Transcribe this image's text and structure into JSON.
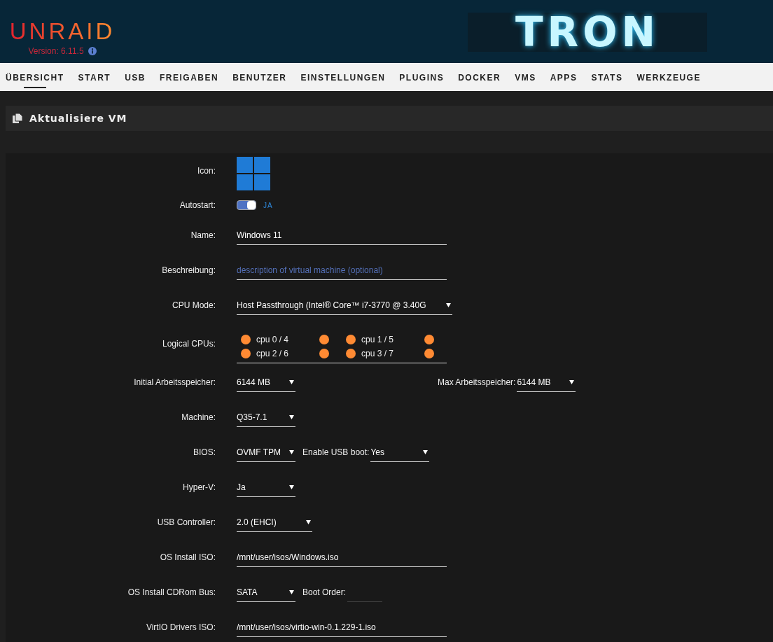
{
  "header": {
    "logo": "UNRAID",
    "version": "Version: 6.11.5",
    "banner_text": "TRON"
  },
  "nav": [
    {
      "label": "ÜBERSICHT",
      "selected": true
    },
    {
      "label": "START",
      "selected": false
    },
    {
      "label": "USB",
      "selected": false
    },
    {
      "label": "FREIGABEN",
      "selected": false
    },
    {
      "label": "BENUTZER",
      "selected": false
    },
    {
      "label": "EINSTELLUNGEN",
      "selected": false
    },
    {
      "label": "PLUGINS",
      "selected": false
    },
    {
      "label": "DOCKER",
      "selected": false
    },
    {
      "label": "VMS",
      "selected": false
    },
    {
      "label": "APPS",
      "selected": false
    },
    {
      "label": "STATS",
      "selected": false
    },
    {
      "label": "WERKZEUGE",
      "selected": false
    }
  ],
  "section": {
    "title": "Aktualisiere VM"
  },
  "form": {
    "rows": [
      {
        "label": "Icon:",
        "controls": [
          {
            "kind": "os-icon"
          }
        ]
      },
      {
        "label": "Autostart:",
        "controls": [
          {
            "kind": "toggle",
            "on": true,
            "text": "JA"
          }
        ]
      },
      {
        "label": "Name:",
        "controls": [
          {
            "kind": "input",
            "value": "Windows 11"
          }
        ]
      },
      {
        "label": "Beschreibung:",
        "controls": [
          {
            "kind": "input",
            "placeholder": "description of virtual machine (optional)"
          }
        ]
      },
      {
        "label": "CPU Mode:",
        "controls": [
          {
            "kind": "select",
            "value": "Host Passthrough (Intel® Core™ i7-3770 @ 3.40G"
          }
        ]
      },
      {
        "label": "Logical CPUs:",
        "controls": [
          {
            "kind": "cpus",
            "cpus": [
              {
                "label": "cpu 0 / 4",
                "checked": true,
                "second_checked": true
              },
              {
                "label": "cpu 1 / 5",
                "checked": true,
                "second_checked": true
              },
              {
                "label": "cpu 2 / 6",
                "checked": true,
                "second_checked": true
              },
              {
                "label": "cpu 3 / 7",
                "checked": true,
                "second_checked": true
              }
            ]
          }
        ]
      },
      {
        "label": "Initial Arbeitsspeicher:",
        "controls": [
          {
            "kind": "select",
            "value": "6144 MB"
          },
          {
            "kind": "label",
            "text": "Max Arbeitsspeicher:"
          },
          {
            "kind": "select",
            "value": "6144 MB"
          }
        ]
      },
      {
        "label": "Machine:",
        "controls": [
          {
            "kind": "select",
            "value": "Q35-7.1"
          }
        ]
      },
      {
        "label": "BIOS:",
        "controls": [
          {
            "kind": "select",
            "value": "OVMF TPM"
          },
          {
            "kind": "label",
            "text": "Enable USB boot:"
          },
          {
            "kind": "select",
            "value": "Yes"
          }
        ]
      },
      {
        "label": "Hyper-V:",
        "controls": [
          {
            "kind": "select",
            "value": "Ja"
          }
        ]
      },
      {
        "label": "USB Controller:",
        "controls": [
          {
            "kind": "select",
            "value": "2.0 (EHCI)"
          }
        ]
      },
      {
        "label": "OS Install ISO:",
        "controls": [
          {
            "kind": "input",
            "value": "/mnt/user/isos/Windows.iso"
          }
        ]
      },
      {
        "label": "OS Install CDRom Bus:",
        "controls": [
          {
            "kind": "select",
            "value": "SATA"
          },
          {
            "kind": "label",
            "text": "Boot Order:"
          },
          {
            "kind": "input"
          }
        ]
      },
      {
        "label": "VirtIO Drivers ISO:",
        "controls": [
          {
            "kind": "input",
            "value": "/mnt/user/isos/virtio-win-0.1.229-1.iso"
          }
        ]
      }
    ]
  }
}
